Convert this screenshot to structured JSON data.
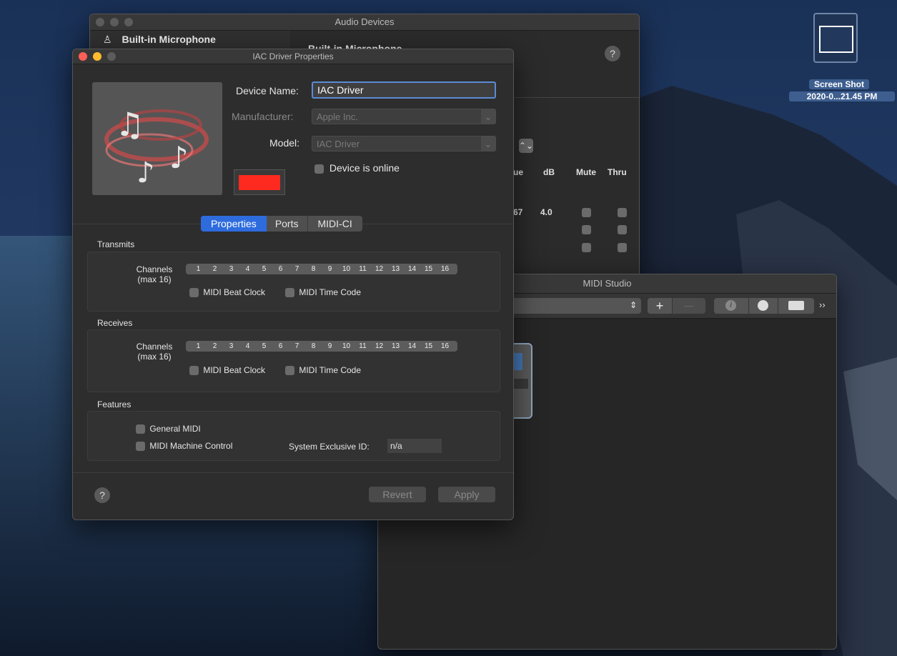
{
  "desktop": {
    "bg_top": "#182a4d",
    "bg_bottom": "#0d1626",
    "thumbnail": {
      "name_line1": "Screen Shot",
      "name_line2": "2020-0...21.45 PM"
    }
  },
  "audio_window": {
    "title": "Audio Devices",
    "sidebar_item": "Built-in Microphone",
    "header_partial": "Built-in Microphone",
    "help": "?",
    "stepper_glyph": "⌃⌄",
    "columns": [
      "ue",
      "dB",
      "Mute",
      "Thru"
    ],
    "row": {
      "value": "67",
      "db": "4.0"
    }
  },
  "midi_window": {
    "title": "MIDI Studio",
    "add": "+",
    "remove": "—",
    "more": "››"
  },
  "iac_window": {
    "title": "IAC Driver Properties",
    "device_name_label": "Device Name:",
    "device_name_value": "IAC Driver",
    "manufacturer_label": "Manufacturer:",
    "manufacturer_value": "Apple Inc.",
    "model_label": "Model:",
    "model_value": "IAC Driver",
    "online_label": "Device is online",
    "color_swatch": "#ff2a1f",
    "tabs": [
      "Properties",
      "Ports",
      "MIDI-CI"
    ],
    "transmits": {
      "title": "Transmits",
      "channels_label_1": "Channels",
      "channels_label_2": "(max 16)",
      "channels": [
        "1",
        "2",
        "3",
        "4",
        "5",
        "6",
        "7",
        "8",
        "9",
        "10",
        "11",
        "12",
        "13",
        "14",
        "15",
        "16"
      ],
      "beat_clock": "MIDI Beat Clock",
      "time_code": "MIDI Time Code"
    },
    "receives": {
      "title": "Receives",
      "channels_label_1": "Channels",
      "channels_label_2": "(max 16)",
      "channels": [
        "1",
        "2",
        "3",
        "4",
        "5",
        "6",
        "7",
        "8",
        "9",
        "10",
        "11",
        "12",
        "13",
        "14",
        "15",
        "16"
      ],
      "beat_clock": "MIDI Beat Clock",
      "time_code": "MIDI Time Code"
    },
    "features": {
      "title": "Features",
      "general_midi": "General MIDI",
      "machine_control": "MIDI Machine Control",
      "sysex_label": "System Exclusive ID:",
      "sysex_value": "n/a"
    },
    "help": "?",
    "revert": "Revert",
    "apply": "Apply"
  }
}
